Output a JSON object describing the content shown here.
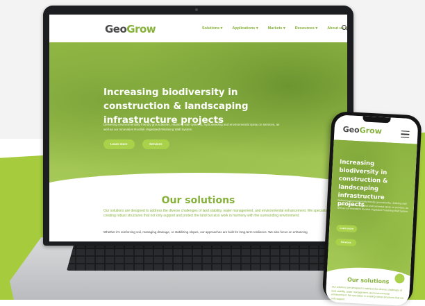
{
  "site": {
    "logo_prefix": "Geo",
    "logo_suffix": "Grow"
  },
  "nav": {
    "items": [
      "Solutions",
      "Applications",
      "Markets",
      "Resources",
      "About us"
    ]
  },
  "hero": {
    "title": "Increasing biodiversity in construction & landscaping infrastructure projects",
    "subtitle": "Delivering environmentally friendly groundworks, retaining wall systems, hydroseeding and environmental spray on services, as well as our innovative Rootlok Vegetated Retaining Wall System.",
    "button_primary": "Learn more",
    "button_secondary": "Services"
  },
  "solutions": {
    "title": "Our solutions",
    "text": "Our solutions are designed to address the diverse challenges of land stability, water management, and environmental enhancement. We specialise in creating robust structures that not only support and protect the land but also work in harmony with the surrounding environment.",
    "text2": "Whether it's reinforcing soil, managing drainage, or stabilizing slopes, our approaches are built for long-term resilience. We also focus on enhancing"
  },
  "mobile": {
    "title": "Increasing biodiversity in construction & landscaping infrastructure projects",
    "subtitle": "Delivering environmentally friendly groundworks, retaining wall systems, hydroseeding and environmental spray on services, as well as our innovative Rootlok Vegetated Retaining Wall System.",
    "button_primary": "Learn more",
    "button_secondary": "Services",
    "solutions_title": "Our solutions",
    "solutions_text": "Our solutions are designed to address the diverse challenges of land stability, water management, and environmental enhancement. We specialise in creating robust structures that not only support"
  },
  "colors": {
    "brand_green": "#86b13a",
    "accent_green": "#a9d14a",
    "logo_gray": "#4a4a4a"
  }
}
